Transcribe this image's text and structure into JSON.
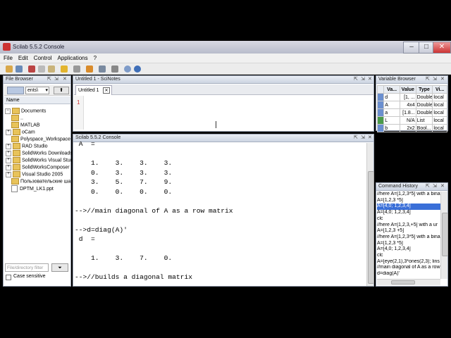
{
  "window": {
    "title": "Scilab 5.5.2 Console",
    "minimize": "–",
    "maximize": "□",
    "close": "✕"
  },
  "menu": [
    "File",
    "Edit",
    "Control",
    "Applications",
    "?"
  ],
  "file_browser": {
    "title": "File Browser",
    "path_value": "ents\\",
    "column_name": "Name",
    "filter_placeholder": "File/directory filter",
    "case_sensitive_label": "Case sensitive",
    "root": "Documents",
    "items": [
      "..",
      "MATLAB",
      "oCam",
      "Polyspace_Workspace",
      "RAD Studio",
      "SolidWorks Downloads",
      "SolidWorks Visual Studi",
      "SolidWorksComposer",
      "Visual Studio 2005",
      "Пользовательские ша",
      "DPTM_LK1.ppt"
    ]
  },
  "scinotes": {
    "title": "Untitled 1 - SciNotes",
    "tab_label": "Untitled 1",
    "tab_close": "✕",
    "line_number": "1"
  },
  "console": {
    "title": "Scilab 5.5.2 Console",
    "lines": [
      " A  =",
      "",
      "    1.    3.    3.    3.",
      "    0.    3.    3.    3.",
      "    3.    5.    7.    9.",
      "    0.    0.    0.    0.",
      "",
      "-->//main diagonal of A as a row matrix",
      "",
      "-->d=diag(A)'",
      " d  =",
      "",
      "    1.    3.    7.    0.",
      "",
      "-->//builds a diagonal matrix"
    ]
  },
  "variable_browser": {
    "title": "Variable Browser",
    "headers": [
      "",
      "Va...",
      "Value",
      "Type",
      "Vi..."
    ],
    "rows": [
      [
        "d",
        "[1, ...",
        "Double",
        "local"
      ],
      [
        "A",
        "4x4",
        "Double",
        "local"
      ],
      [
        "a",
        "[1.8...",
        "Double",
        "local"
      ],
      [
        "L",
        "N/A",
        "List",
        "local"
      ],
      [
        "b",
        "2x2",
        "Bool...",
        "local"
      ]
    ]
  },
  "command_history": {
    "title": "Command History",
    "items": [
      "//here A=[1,2,3*5] with a bina",
      "A=[1,2,3 *5]",
      "A=[4,0; 1,2,3,4]",
      "A=[4,0; 1,2,3,4]",
      "clc",
      "//here A=[1,2,3,+5] with a ur",
      "A=[1,2,3 +5]",
      "//here A=[1,2,3*5] with a bina",
      "A=[1,2,3 *5]",
      "A=[4,0; 1,2,3,4]",
      "clc",
      "A=[eye(2,1),3*ones(2,3); lins",
      "//main diagonal of A as a row r",
      "d=diag(A)'"
    ],
    "selected_index": 2
  }
}
